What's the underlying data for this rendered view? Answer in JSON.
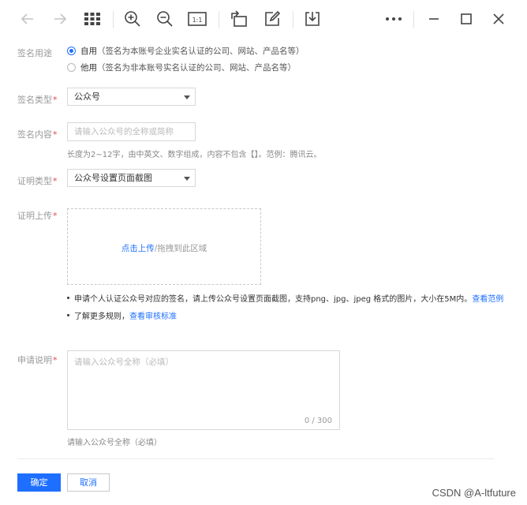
{
  "toolbar": {
    "icons": [
      "back-arrow-icon",
      "forward-arrow-icon",
      "grid-view-icon",
      "zoom-in-icon",
      "zoom-out-icon",
      "actual-size-icon",
      "rotate-icon",
      "edit-icon",
      "download-icon",
      "more-icon",
      "minimize-icon",
      "maximize-icon",
      "close-icon"
    ],
    "actual_size_label": "1:1"
  },
  "form": {
    "usage": {
      "label": "签名用途",
      "options": [
        {
          "main": "自用",
          "desc": "（签名为本账号企业实名认证的公司、网站、产品名等）",
          "checked": true
        },
        {
          "main": "他用",
          "desc": "（签名为非本账号实名认证的公司、网站、产品名等）",
          "checked": false
        }
      ]
    },
    "sign_type": {
      "label": "签名类型",
      "required": "*",
      "value": "公众号"
    },
    "sign_content": {
      "label": "签名内容",
      "required": "*",
      "placeholder": "请输入公众号的全称或简称",
      "hint": "长度为2~12字，由中英文、数字组成，内容不包含【】。范例：腾讯云。"
    },
    "proof_type": {
      "label": "证明类型",
      "required": "*",
      "value": "公众号设置页面截图"
    },
    "proof_upload": {
      "label": "证明上传",
      "required": "*",
      "click_text": "点击上传",
      "drag_text": "/拖拽到此区域",
      "bullet1_text": "申请个人认证公众号对应的签名，请上传公众号设置页面截图，支持png、jpg、jpeg 格式的图片，大小在5M内。",
      "bullet1_link": "查看范例",
      "bullet2_text": "了解更多规则，",
      "bullet2_link": "查看审核标准"
    },
    "description": {
      "label": "申请说明",
      "required": "*",
      "placeholder": "请输入公众号全称（必填）",
      "counter": "0 / 300",
      "hint": "请输入公众号全称（必填）"
    }
  },
  "buttons": {
    "confirm": "确定",
    "cancel": "取消"
  },
  "watermark": "CSDN @A-ltfuture",
  "colors": {
    "accent": "#1e6fff",
    "required": "#e54545"
  }
}
